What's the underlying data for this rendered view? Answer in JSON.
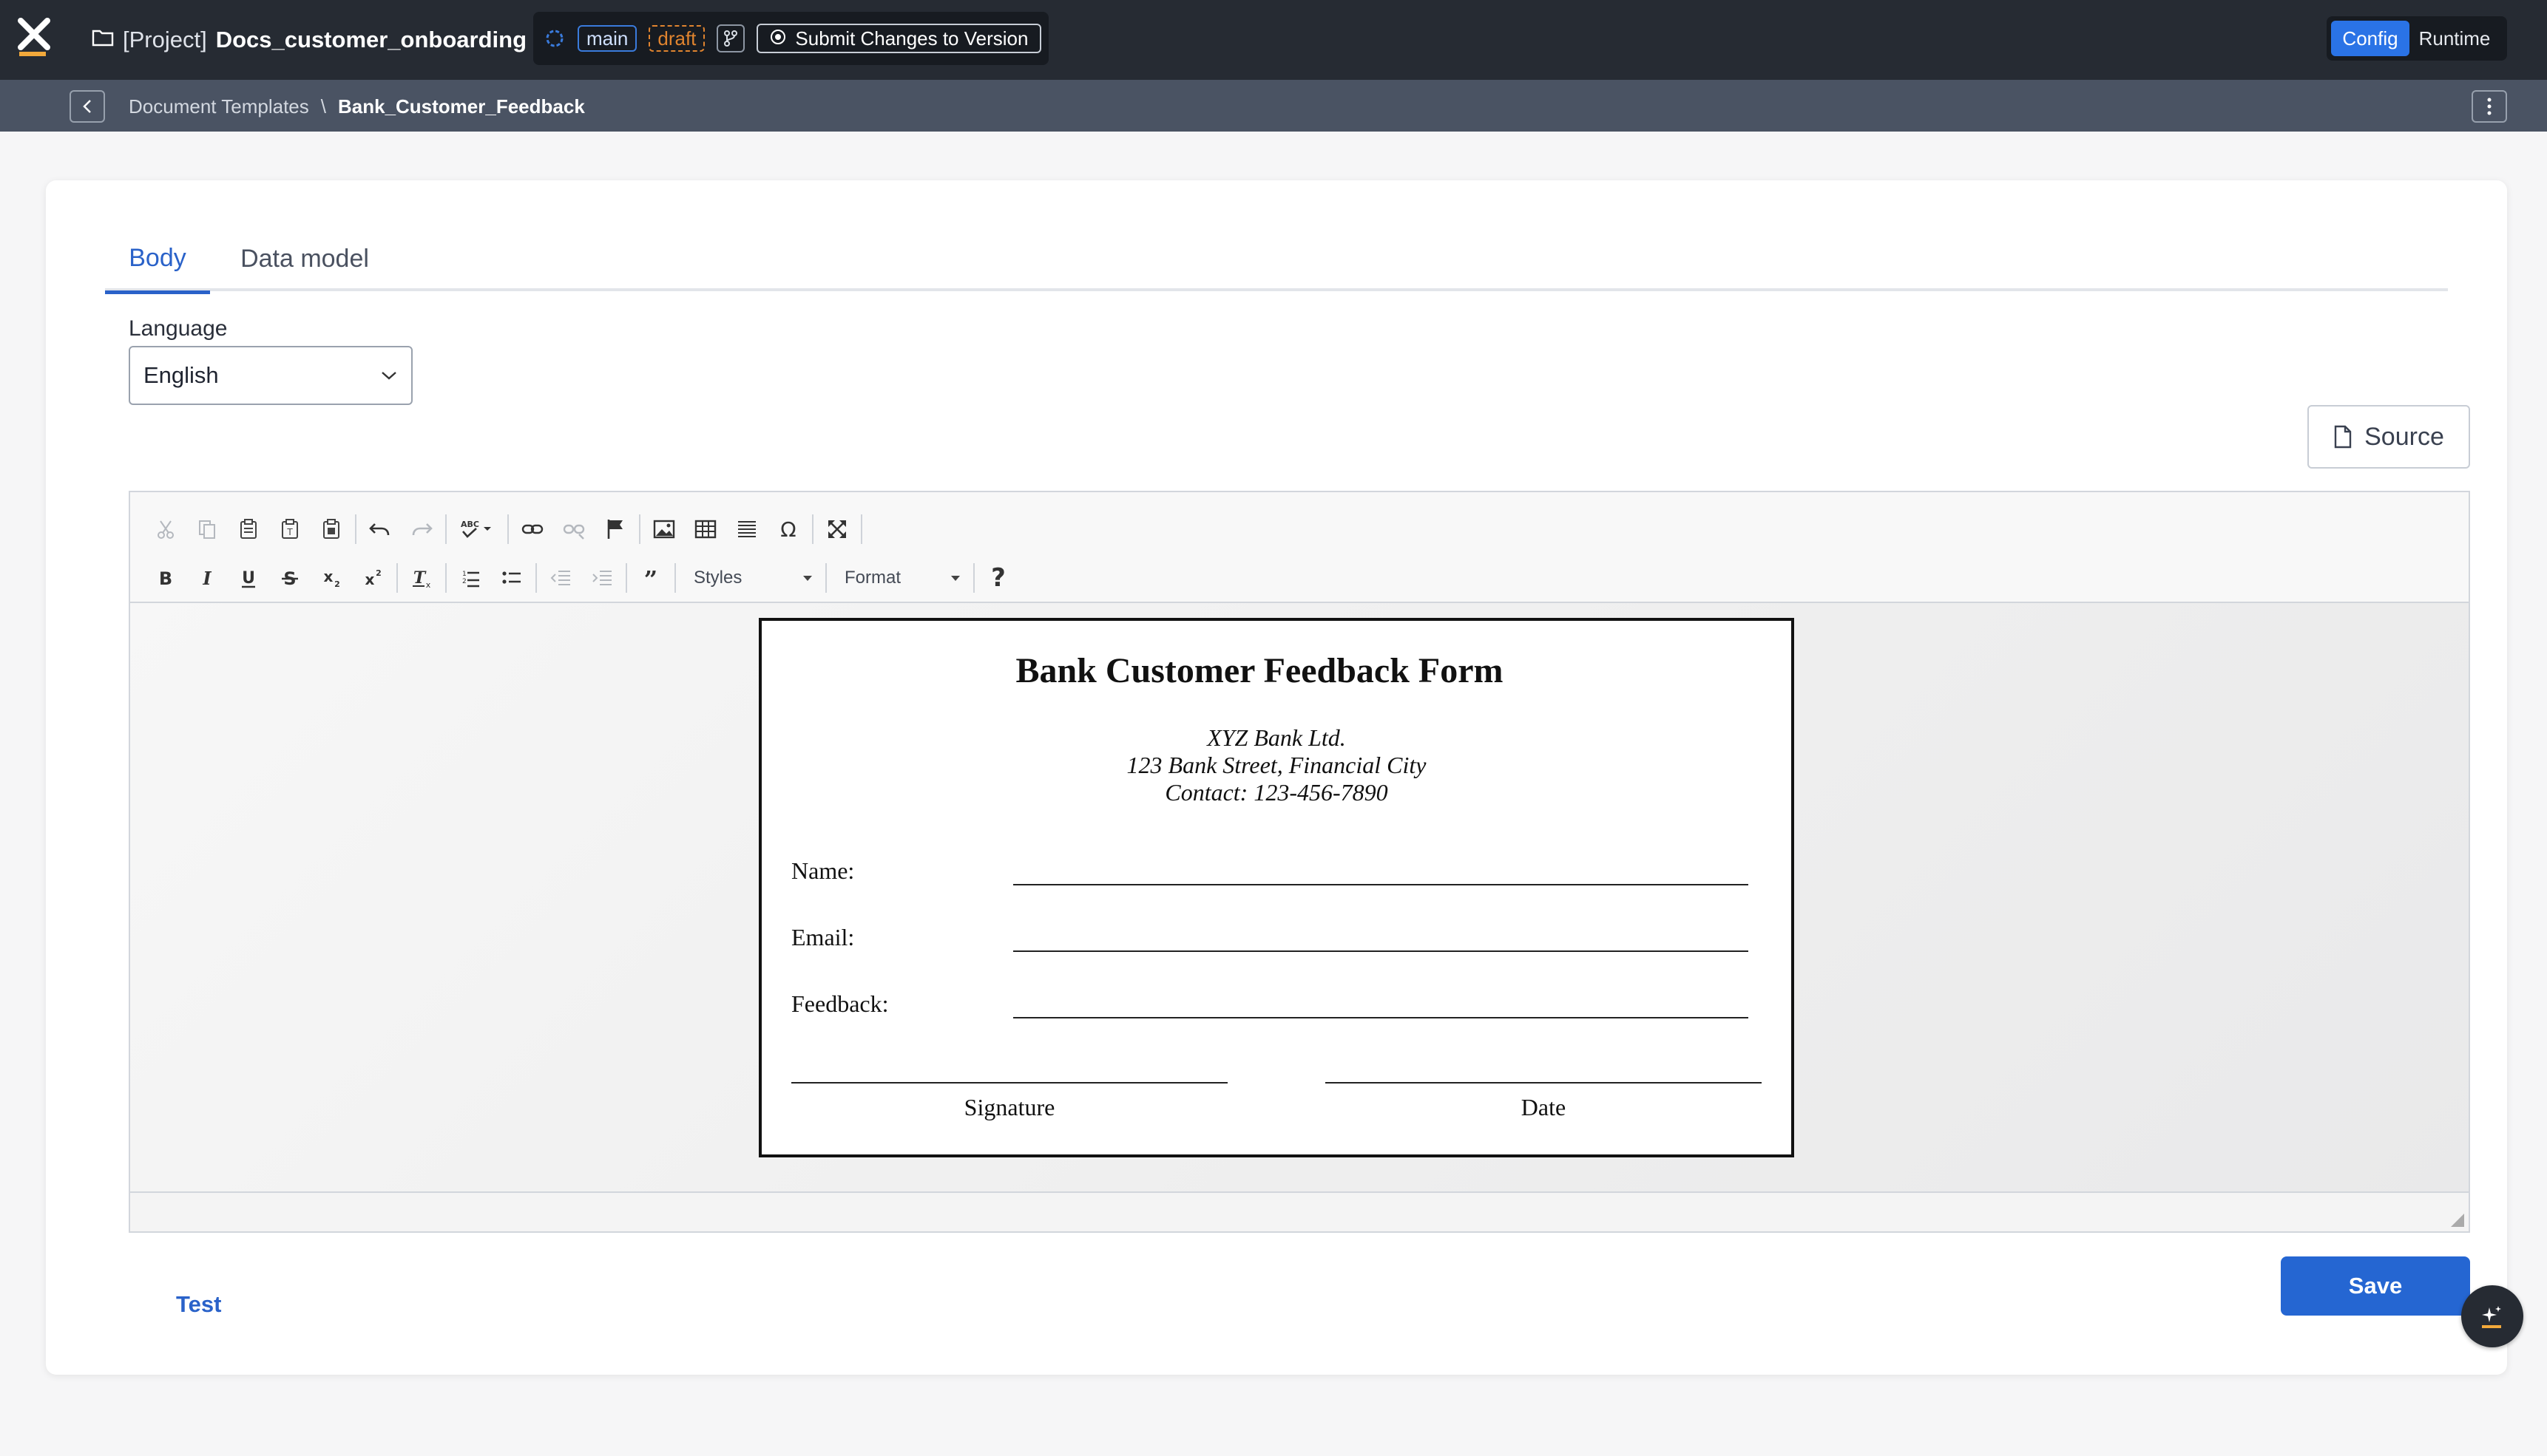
{
  "app": {
    "logo_icon": "x-logo-icon",
    "project_prefix": "[Project]",
    "project_name": "Docs_customer_onboarding",
    "branch": "main",
    "branch_state": "draft",
    "submit_label": "Submit Changes to Version",
    "modes": [
      "Config",
      "Runtime"
    ],
    "active_mode": "Config",
    "accent": "#2a73e6"
  },
  "breadcrumb": {
    "parent": "Document Templates",
    "separator": "\\",
    "current": "Bank_Customer_Feedback"
  },
  "tabs": [
    {
      "label": "Body",
      "active": true
    },
    {
      "label": "Data model",
      "active": false
    }
  ],
  "language": {
    "label": "Language",
    "value": "English"
  },
  "source_button": "Source",
  "toolbar": {
    "row1": [
      "cut-icon",
      "copy-icon",
      "paste-icon",
      "paste-text-icon",
      "paste-word-icon",
      "undo-icon",
      "redo-icon",
      "spellcheck-icon",
      "link-icon",
      "unlink-icon",
      "anchor-icon",
      "image-icon",
      "table-icon",
      "horizontal-line-icon",
      "special-char-icon",
      "maximize-icon"
    ],
    "row2": [
      "bold-icon",
      "italic-icon",
      "underline-icon",
      "strikethrough-icon",
      "subscript-icon",
      "superscript-icon",
      "remove-format-icon",
      "numbered-list-icon",
      "bulleted-list-icon",
      "outdent-icon",
      "indent-icon",
      "blockquote-icon"
    ],
    "styles_label": "Styles",
    "format_label": "Format",
    "help_label": "?"
  },
  "document": {
    "title": "Bank Customer Feedback Form",
    "address_lines": [
      "XYZ Bank Ltd.",
      "123 Bank Street, Financial City",
      "Contact: 123-456-7890"
    ],
    "fields": [
      "Name:",
      "Email:",
      "Feedback:"
    ],
    "signature_label": "Signature",
    "date_label": "Date"
  },
  "actions": {
    "test_label": "Test",
    "save_label": "Save",
    "assistant_icon": "ai-sparkle-icon"
  }
}
